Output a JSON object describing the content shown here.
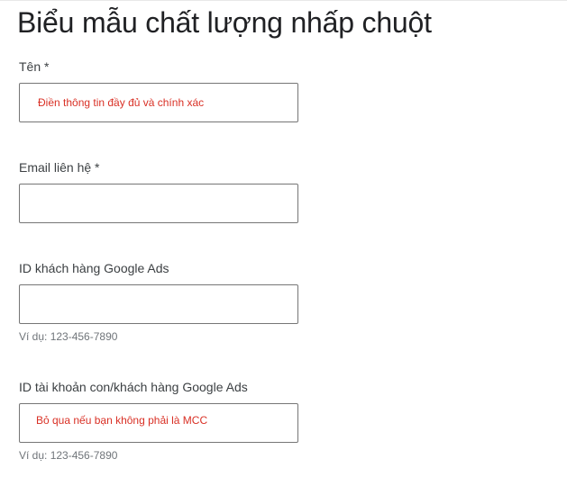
{
  "form": {
    "title": "Biểu mẫu chất lượng nhấp chuột",
    "fields": [
      {
        "label": "Tên *",
        "placeholder": "Điền thông tin đầy đủ và chính xác",
        "value": "",
        "hint": ""
      },
      {
        "label": "Email liên hệ *",
        "placeholder": "",
        "value": "",
        "hint": ""
      },
      {
        "label": "ID khách hàng Google Ads",
        "placeholder": "",
        "value": "",
        "hint": "Ví dụ: 123-456-7890"
      },
      {
        "label": "ID tài khoản con/khách hàng Google Ads",
        "placeholder": "Bỏ qua nếu bạn không phải là MCC",
        "value": "",
        "hint": "Ví dụ: 123-456-7890"
      }
    ]
  },
  "colors": {
    "placeholder_text": "#d93025",
    "label_text": "#3c4043",
    "hint_text": "#70757a",
    "field_border": "#767676"
  }
}
